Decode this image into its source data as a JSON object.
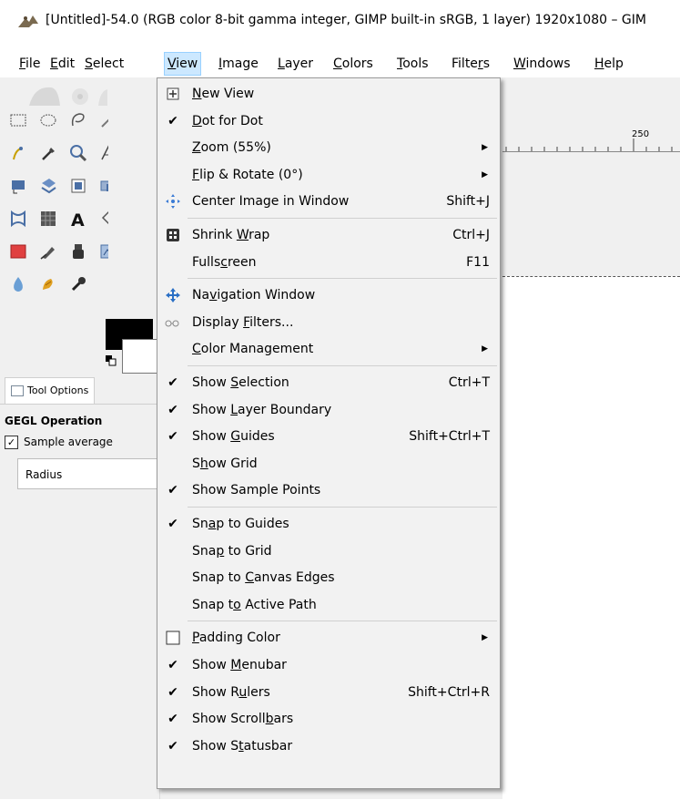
{
  "window": {
    "title": "[Untitled]-54.0 (RGB color 8-bit gamma integer, GIMP built-in sRGB, 1 layer) 1920x1080 – GIM"
  },
  "menubar": {
    "items": [
      {
        "label": "File",
        "mnemonic_index": 0
      },
      {
        "label": "Edit",
        "mnemonic_index": 0
      },
      {
        "label": "Select",
        "mnemonic_index": 0
      },
      {
        "label": "View",
        "mnemonic_index": 0,
        "active": true
      },
      {
        "label": "Image",
        "mnemonic_index": 0
      },
      {
        "label": "Layer",
        "mnemonic_index": 0
      },
      {
        "label": "Colors",
        "mnemonic_index": 0
      },
      {
        "label": "Tools",
        "mnemonic_index": 0
      },
      {
        "label": "Filters",
        "mnemonic_index": 5
      },
      {
        "label": "Windows",
        "mnemonic_index": 0
      },
      {
        "label": "Help",
        "mnemonic_index": 0
      }
    ]
  },
  "view_menu": {
    "items": [
      {
        "label": "New View",
        "u": 0,
        "icon": "new-view-icon",
        "check": false
      },
      {
        "label": "Dot for Dot",
        "u": 0,
        "check": true
      },
      {
        "label": "Zoom (55%)",
        "u": 0,
        "submenu": true
      },
      {
        "label": "Flip & Rotate (0°)",
        "u": 0,
        "submenu": true
      },
      {
        "label": "Center Image in Window",
        "u": -1,
        "icon": "center-icon",
        "shortcut": "Shift+J"
      },
      {
        "sep": true
      },
      {
        "label": "Shrink Wrap",
        "u": 7,
        "icon": "shrink-wrap-icon",
        "shortcut": "Ctrl+J"
      },
      {
        "label": "Fullscreen",
        "u": 5,
        "shortcut": "F11"
      },
      {
        "sep": true
      },
      {
        "label": "Navigation Window",
        "u": 2,
        "icon": "navigation-icon"
      },
      {
        "label": "Display Filters...",
        "u": 8,
        "icon": "display-filters-icon"
      },
      {
        "label": "Color Management",
        "u": 0,
        "submenu": true
      },
      {
        "sep": true
      },
      {
        "label": "Show Selection",
        "u": 5,
        "check": true,
        "shortcut": "Ctrl+T"
      },
      {
        "label": "Show Layer Boundary",
        "u": 5,
        "check": true
      },
      {
        "label": "Show Guides",
        "u": 5,
        "check": true,
        "shortcut": "Shift+Ctrl+T"
      },
      {
        "label": "Show Grid",
        "u": 1,
        "check": false
      },
      {
        "label": "Show Sample Points",
        "u": -1,
        "check": true
      },
      {
        "sep": true
      },
      {
        "label": "Snap to Guides",
        "u": 2,
        "check": true
      },
      {
        "label": "Snap to Grid",
        "u": 3,
        "check": false
      },
      {
        "label": "Snap to Canvas Edges",
        "u": 8,
        "check": false
      },
      {
        "label": "Snap to Active Path",
        "u": 6,
        "check": false
      },
      {
        "sep": true
      },
      {
        "label": "Padding Color",
        "u": 0,
        "icon": "padding-color-swatch",
        "submenu": true
      },
      {
        "label": "Show Menubar",
        "u": 5,
        "check": true
      },
      {
        "label": "Show Rulers",
        "u": 6,
        "check": true,
        "shortcut": "Shift+Ctrl+R"
      },
      {
        "label": "Show Scrollbars",
        "u": 11,
        "check": true
      },
      {
        "label": "Show Statusbar",
        "u": 6,
        "check": true
      }
    ]
  },
  "tool_options": {
    "tab_label": "Tool Options",
    "heading": "GEGL Operation",
    "sample_average_label": "Sample average",
    "sample_average_checked": true,
    "radius_label": "Radius"
  },
  "ruler": {
    "label": "250"
  },
  "colors": {
    "menu_bg": "#f2f2f2",
    "menubar_active": "#cce8ff",
    "foreground": "#000000",
    "background": "#ffffff"
  }
}
